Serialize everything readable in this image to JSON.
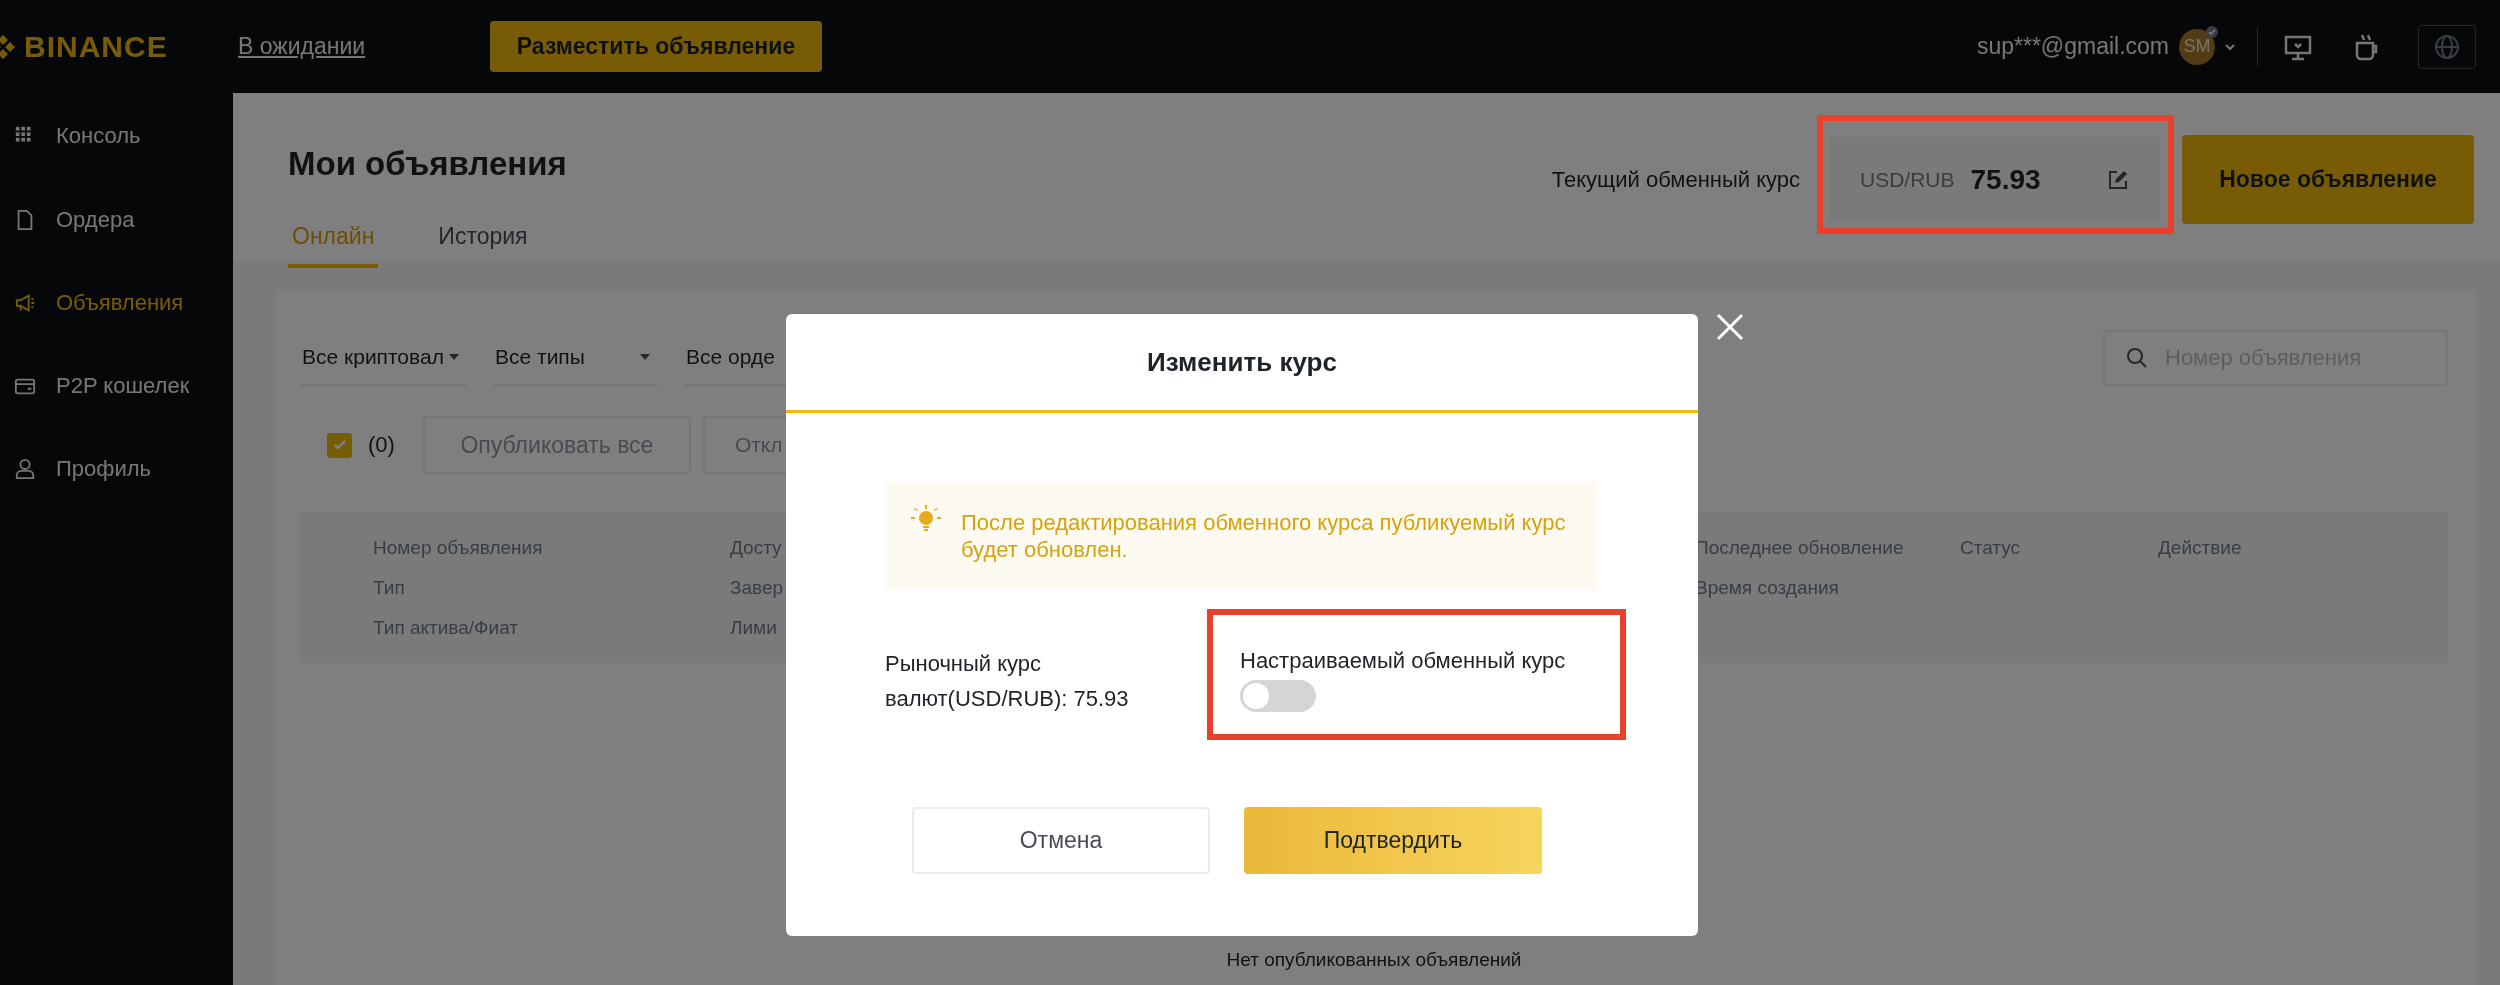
{
  "topbar": {
    "brand": "BINANCE",
    "pending_link": "В ожидании",
    "post_button": "Разместить объявление",
    "email": "sup***@gmail.com",
    "avatar": "SM"
  },
  "sidebar": {
    "items": [
      {
        "label": "Консоль",
        "selected": false
      },
      {
        "label": "Ордера",
        "selected": false
      },
      {
        "label": "Объявления",
        "selected": true
      },
      {
        "label": "P2P кошелек",
        "selected": false
      },
      {
        "label": "Профиль",
        "selected": false
      }
    ]
  },
  "header": {
    "title": "Мои объявления",
    "tabs": [
      {
        "label": "Онлайн",
        "selected": true
      },
      {
        "label": "История",
        "selected": false
      }
    ],
    "rate_label": "Текущий обменный курс",
    "rate_pair": "USD/RUB",
    "rate_value": "75.93",
    "rate_highlighted": true,
    "new_ad_button": "Новое объявление"
  },
  "filters": {
    "selects": [
      "Все криптовал",
      "Все типы",
      "Все орде"
    ],
    "search_placeholder": "Номер объявления"
  },
  "bulk": {
    "checked": true,
    "count": "(0)",
    "buttons": [
      {
        "label": "Опубликовать все",
        "disabled": true
      },
      {
        "label": "Откл",
        "disabled": true
      }
    ]
  },
  "table": {
    "columns": [
      [
        "Номер объявления",
        "Тип",
        "Тип актива/Фиат"
      ],
      [
        "Досту",
        "Завер",
        "Лими"
      ],
      [
        "Последнее обновление",
        "Время создания"
      ],
      [
        "Статус"
      ],
      [
        "Действие"
      ]
    ],
    "empty_text": "Нет опубликованных объявлений"
  },
  "modal": {
    "title": "Изменить курс",
    "notice": "После редактирования обменного курса публикуемый курс будет обновлен.",
    "market_rate": "Рыночный курс валют(USD/RUB): 75.93",
    "custom_rate_label": "Настраиваемый обменный курс",
    "custom_rate_on": false,
    "custom_rate_highlighted": true,
    "cancel": "Отмена",
    "confirm": "Подтвердить"
  }
}
